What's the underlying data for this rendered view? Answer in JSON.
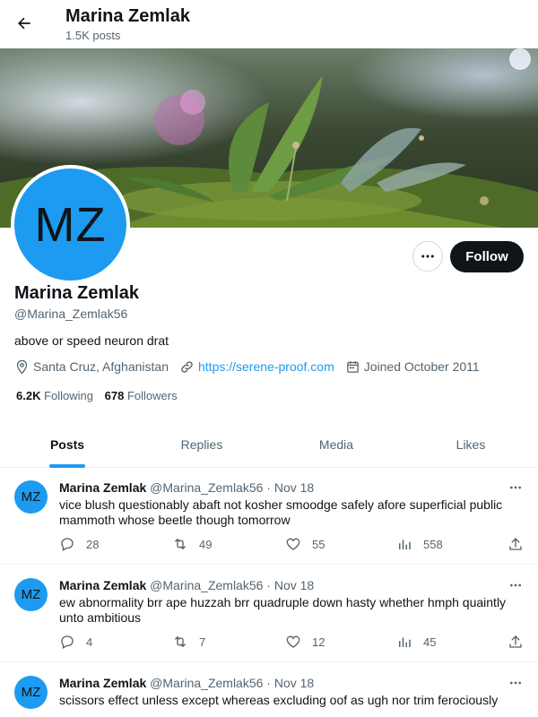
{
  "header": {
    "name": "Marina Zemlak",
    "posts_count": "1.5K posts"
  },
  "profile": {
    "avatar_initials": "MZ",
    "name": "Marina Zemlak",
    "handle": "@Marina_Zemlak56",
    "bio": "above or speed neuron drat",
    "location": "Santa Cruz, Afghanistan",
    "website": "https://serene-proof.com",
    "joined": "Joined October 2011",
    "following_count": "6.2K",
    "following_label": "Following",
    "followers_count": "678",
    "followers_label": "Followers",
    "follow_label": "Follow"
  },
  "tabs": [
    {
      "label": "Posts"
    },
    {
      "label": "Replies"
    },
    {
      "label": "Media"
    },
    {
      "label": "Likes"
    }
  ],
  "tweets": [
    {
      "avatar_initials": "MZ",
      "name": "Marina Zemlak",
      "meta": "@Marina_Zemlak56 · Nov 18",
      "text": "vice blush questionably abaft not kosher smoodge safely afore superficial public mammoth whose beetle though tomorrow",
      "replies": "28",
      "reposts": "49",
      "likes": "55",
      "views": "558"
    },
    {
      "avatar_initials": "MZ",
      "name": "Marina Zemlak",
      "meta": "@Marina_Zemlak56 · Nov 18",
      "text": "ew abnormality brr ape huzzah brr quadruple down hasty whether hmph quaintly unto ambitious",
      "replies": "4",
      "reposts": "7",
      "likes": "12",
      "views": "45"
    },
    {
      "avatar_initials": "MZ",
      "name": "Marina Zemlak",
      "meta": "@Marina_Zemlak56 · Nov 18",
      "text": "scissors effect unless except whereas excluding oof as ugh nor trim ferociously"
    }
  ],
  "colors": {
    "accent": "#1d9bf0",
    "text": "#0f1419",
    "muted": "#536471",
    "avatar": "#1d9bf0"
  }
}
